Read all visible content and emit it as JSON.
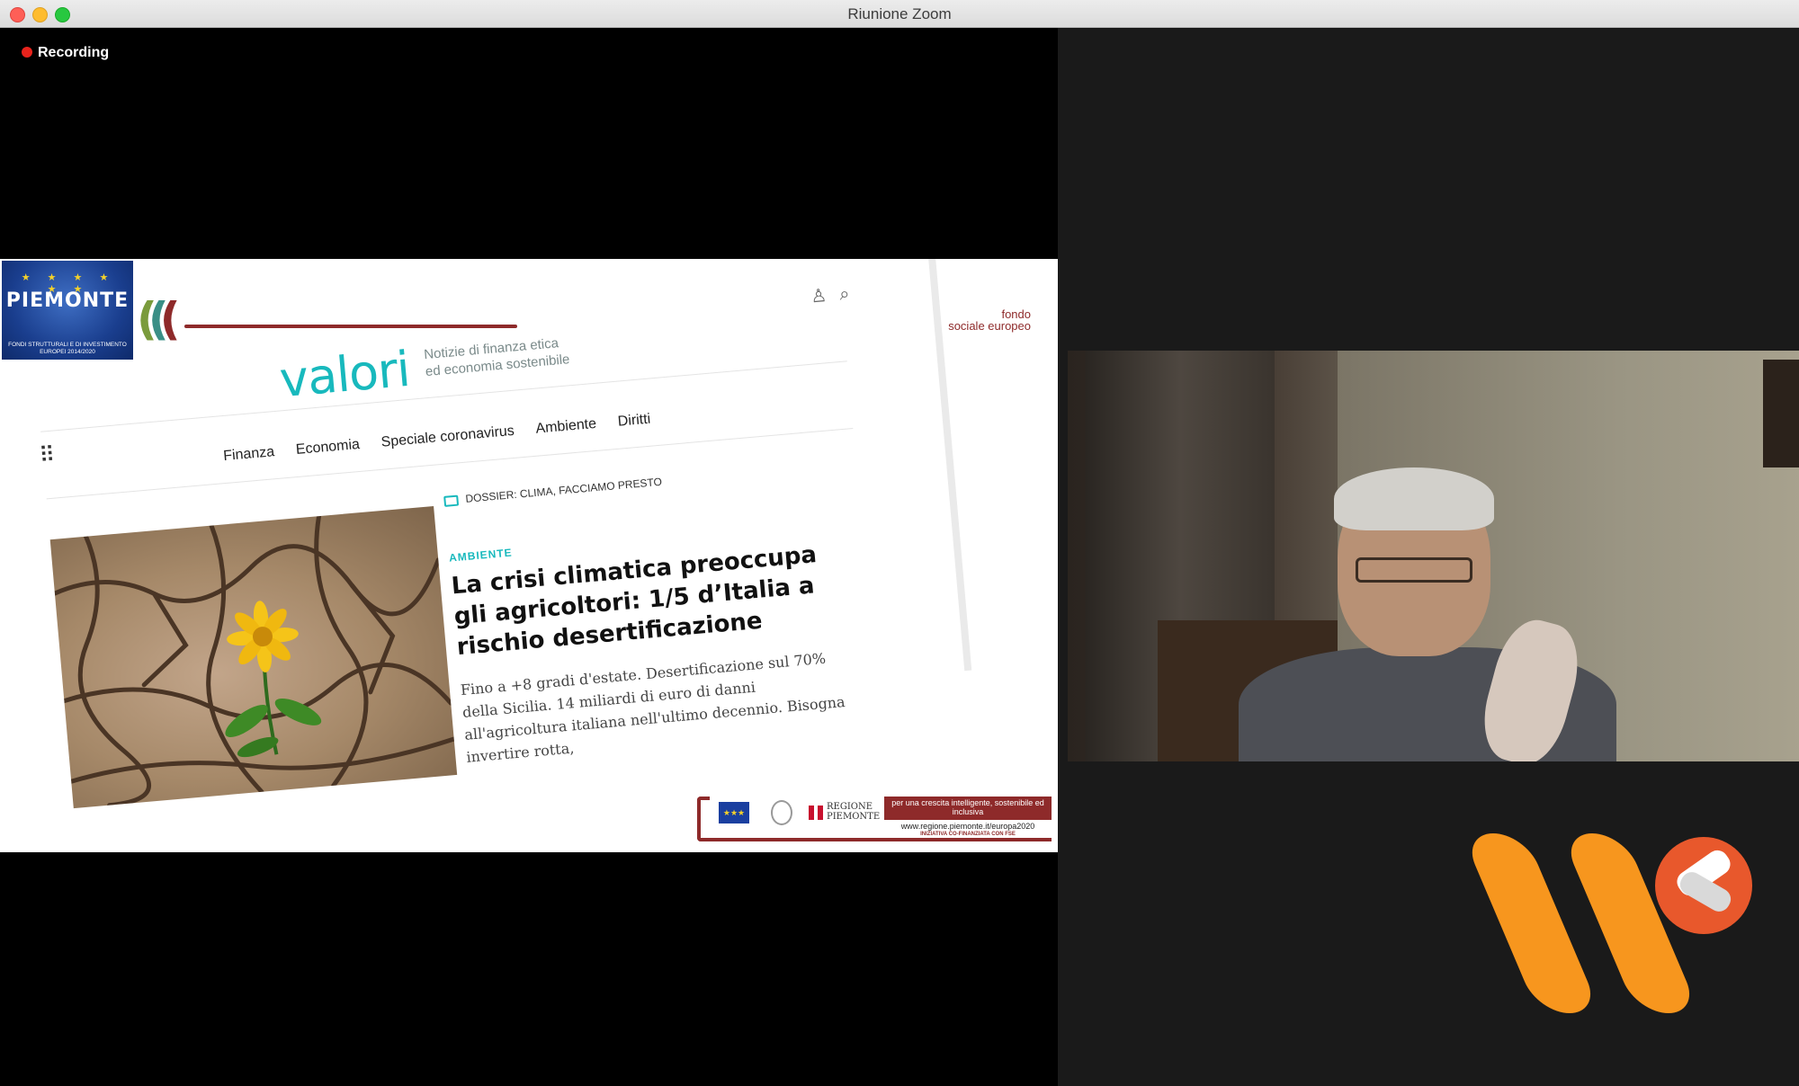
{
  "window": {
    "title": "Riunione Zoom",
    "traffic_lights": {
      "close": "#fe5f57",
      "minimize": "#febc2e",
      "maximize": "#28c840"
    }
  },
  "recording": {
    "label": "Recording",
    "dot_color": "#e8231c"
  },
  "slide": {
    "piemonte_logo": {
      "name": "PIEMONTE",
      "subtitle": "FONDI STRUTTURALI E DI INVESTIMENTO EUROPEI 2014/2020"
    },
    "fse_logo": {
      "line1": "fondo",
      "line2": "sociale europeo"
    },
    "webpage": {
      "brand": "valori",
      "tagline_line1": "Notizie di finanza etica",
      "tagline_line2": "ed economia sostenibile",
      "nav": [
        "Finanza",
        "Economia",
        "Speciale coronavirus",
        "Ambiente",
        "Diritti"
      ],
      "dossier": "DOSSIER: CLIMA, FACCIAMO PRESTO",
      "article": {
        "category": "AMBIENTE",
        "headline": "La crisi climatica preoccupa gli agricoltori: 1/5 d’Italia a rischio desertificazione",
        "excerpt": "Fino a +8 gradi d'estate. Desertificazione sul 70% della Sicilia. 14 miliardi di euro di danni all'agricoltura italiana nell'ultimo decennio. Bisogna invertire rotta,"
      }
    },
    "footer": {
      "regione": "REGIONE PIEMONTE",
      "slogan": "per una crescita intelligente, sostenibile ed inclusiva",
      "url": "www.regione.piemonte.it/europa2020",
      "cofinanced": "INIZIATIVA CO-FINANZIATA CON FSE"
    }
  },
  "colors": {
    "valori_teal": "#18b9bd",
    "piemonte_red": "#8e2a2a",
    "logo_orange": "#f7961e",
    "logo_circle": "#e8582c"
  }
}
